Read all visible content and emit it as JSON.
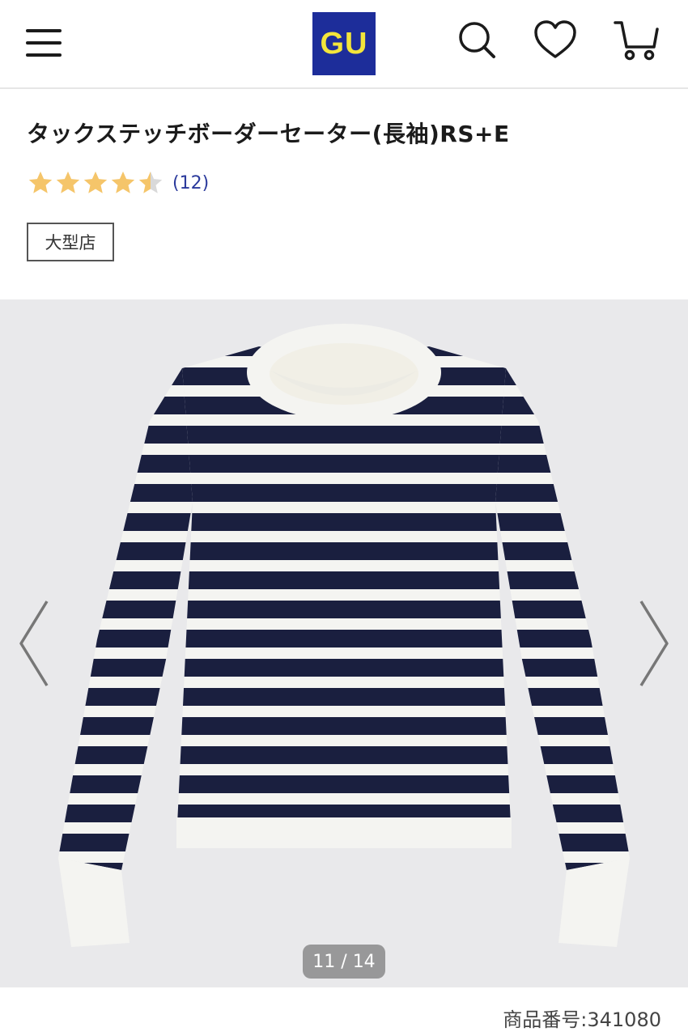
{
  "header": {
    "logo_text": "GU",
    "brand_color": "#1d2d9a",
    "logo_text_color": "#f3e53b",
    "icons": [
      "menu-icon",
      "search-icon",
      "heart-icon",
      "cart-icon"
    ]
  },
  "product": {
    "title": "タックステッチボーダーセーター(長袖)RS+E",
    "rating": 4.5,
    "star_color": "#f5c56a",
    "review_count": "(12)",
    "tag": "大型店"
  },
  "gallery": {
    "counter": "11 / 14",
    "current": 11,
    "total": 14,
    "image_subject": "navy and white striped sweater"
  },
  "product_number": {
    "label": "商品番号:",
    "value": "341080"
  }
}
